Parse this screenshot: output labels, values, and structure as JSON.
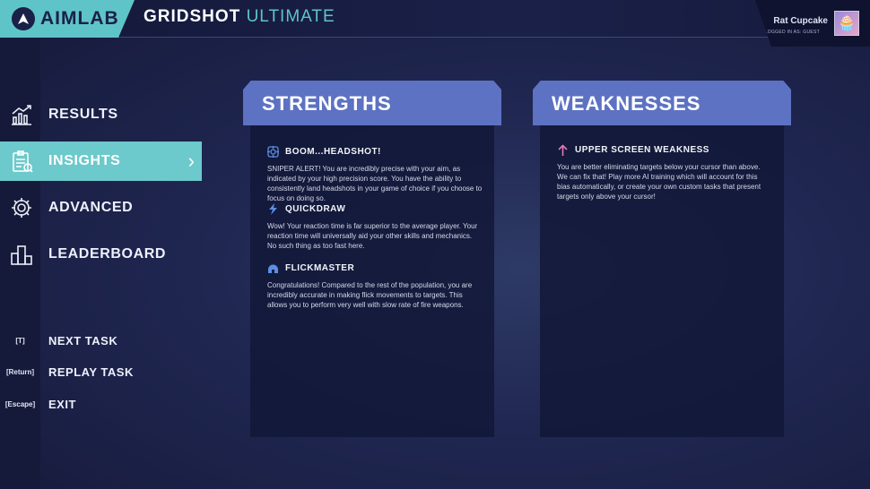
{
  "brand": {
    "logo_text": "AIMLAB"
  },
  "header": {
    "title_main": "GRIDSHOT",
    "title_accent": "ULTIMATE"
  },
  "user": {
    "name": "Rat Cupcake",
    "logged_in": "LOGGED IN AS: GUEST"
  },
  "nav": {
    "items": [
      {
        "label": "RESULTS",
        "icon": "chart-icon"
      },
      {
        "label": "INSIGHTS",
        "icon": "clipboard-icon",
        "active": true
      },
      {
        "label": "ADVANCED",
        "icon": "gear-icon"
      },
      {
        "label": "LEADERBOARD",
        "icon": "podium-icon"
      }
    ]
  },
  "tasks": [
    {
      "key": "[T]",
      "label": "NEXT TASK"
    },
    {
      "key": "[Return]",
      "label": "REPLAY TASK"
    },
    {
      "key": "[Escape]",
      "label": "EXIT"
    }
  ],
  "strengths": {
    "heading": "STRENGTHS",
    "items": [
      {
        "icon": "crosshair-icon",
        "title": "BOOM...HEADSHOT!",
        "text": "SNIPER ALERT! You are incredibly precise with your aim, as indicated by your high precision score. You have the ability to consistently land headshots in your game of choice if you choose to focus on doing so."
      },
      {
        "icon": "lightning-icon",
        "title": "QUICKDRAW",
        "text": "Wow! Your reaction time is far superior to the average player. Your reaction time will universally aid your other skills and mechanics. No such thing as too fast here."
      },
      {
        "icon": "helmet-icon",
        "title": "FLICKMASTER",
        "text": "Congratulations! Compared to the rest of the population, you are incredibly accurate in making flick movements to targets. This allows you to perform very well with slow rate of fire weapons."
      }
    ]
  },
  "weaknesses": {
    "heading": "WEAKNESSES",
    "items": [
      {
        "icon": "arrow-up-icon",
        "title": "UPPER SCREEN WEAKNESS",
        "text": "You are better eliminating targets below your cursor than above. We can fix that! Play more AI training which will account for this bias automatically, or create your own custom tasks that present targets only above your cursor!"
      }
    ]
  },
  "colors": {
    "accent": "#5fc4c8",
    "panel_header": "#5d72c2",
    "insight_icon": "#5b8fe6",
    "weak_icon": "#e07ab8"
  }
}
